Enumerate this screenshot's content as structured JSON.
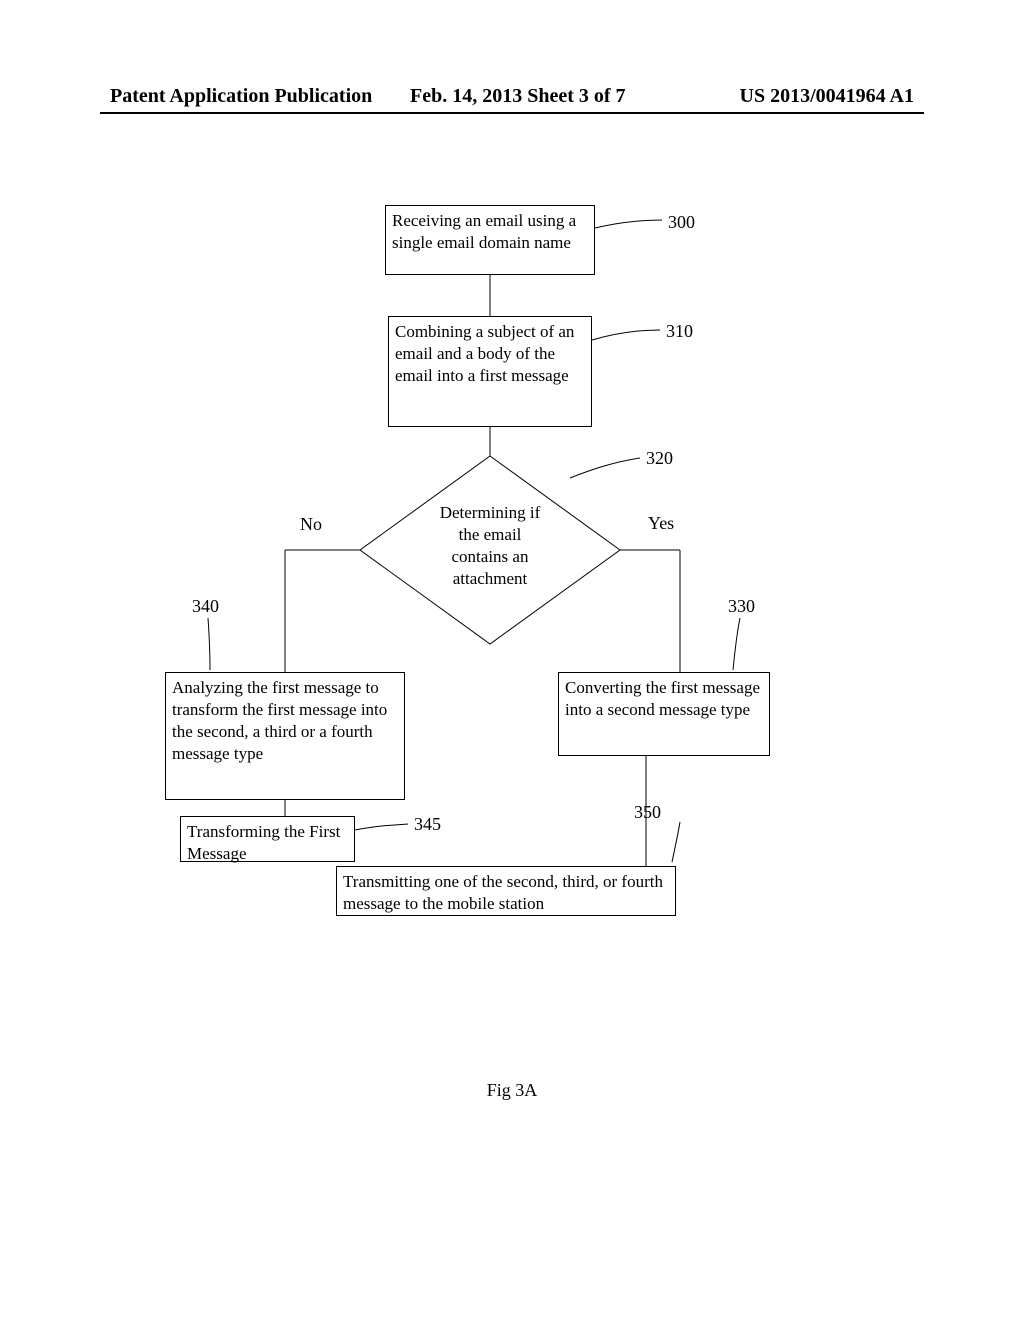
{
  "header": {
    "pubtype": "Patent Application Publication",
    "date": "Feb. 14, 2013  Sheet 3 of 7",
    "pubnum": "US 2013/0041964 A1"
  },
  "nodes": {
    "n300": {
      "text": "Receiving an email using a single email domain name",
      "ref": "300"
    },
    "n310": {
      "text": "Combining a subject of an email and a body of the email into a first message",
      "ref": "310"
    },
    "n320": {
      "text": "Determining if the email contains an attachment",
      "ref": "320"
    },
    "n330": {
      "text": "Converting the first message into a second message type",
      "ref": "330"
    },
    "n340": {
      "text": "Analyzing the first message to transform the first message into the second, a third or a fourth message type",
      "ref": "340"
    },
    "n345": {
      "text": "Transforming the First Message",
      "ref": "345"
    },
    "n350": {
      "text": "Transmitting one of the second, third, or fourth message to the mobile station",
      "ref": "350"
    }
  },
  "edges": {
    "yes": "Yes",
    "no": "No"
  },
  "figure_caption": "Fig 3A"
}
